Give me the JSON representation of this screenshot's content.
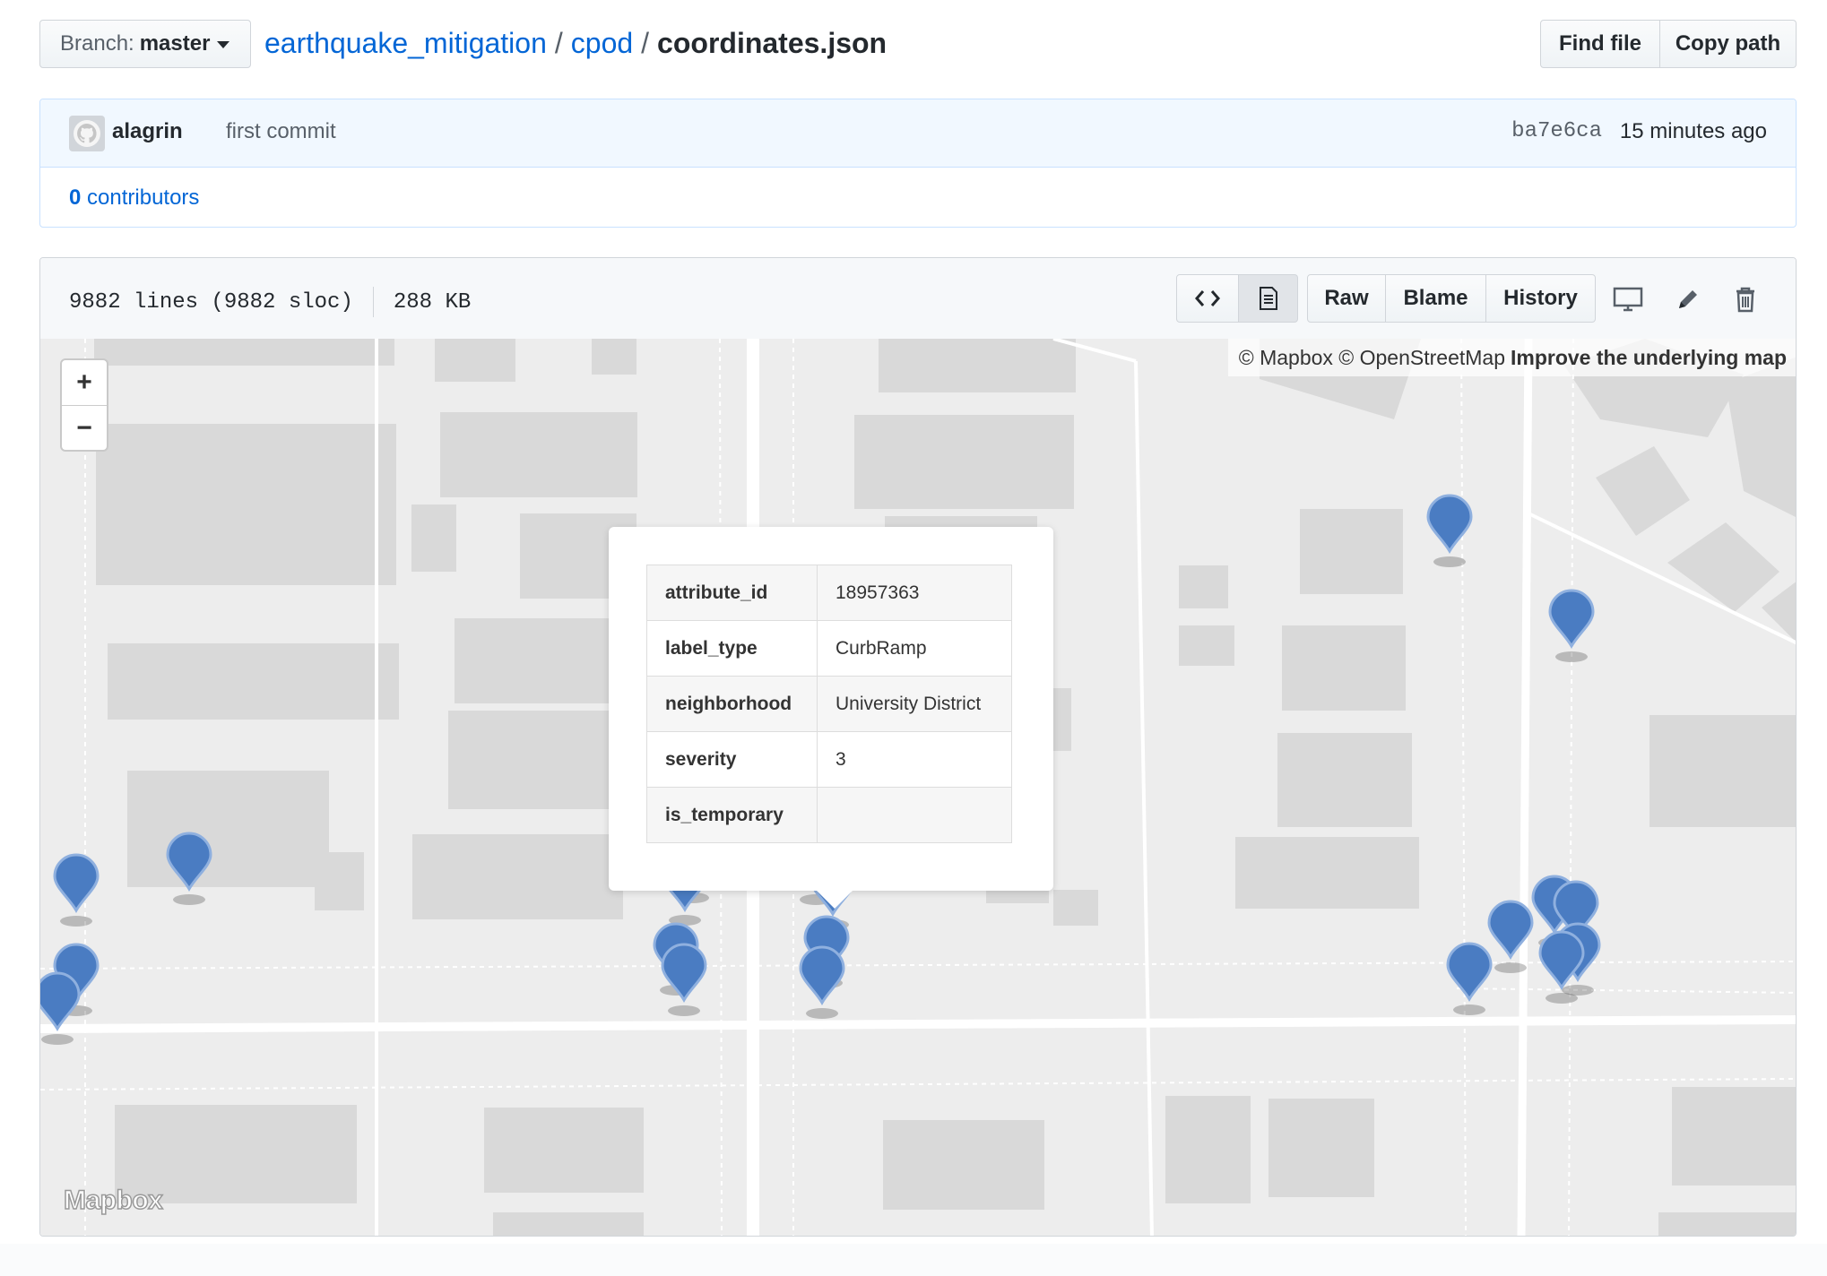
{
  "header": {
    "branch_prefix": "Branch:",
    "branch_name": "master",
    "breadcrumb": [
      "earthquake_mitigation",
      "cpod",
      "coordinates.json"
    ],
    "breadcrumb_sep": "/",
    "find_file_label": "Find file",
    "copy_path_label": "Copy path"
  },
  "commit": {
    "author": "alagrin",
    "message": "first commit",
    "sha": "ba7e6ca",
    "time_ago": "15 minutes ago",
    "contributors_count": "0",
    "contributors_label": "contributors"
  },
  "file": {
    "lines": "9882 lines (9882 sloc)",
    "size": "288 KB",
    "raw_label": "Raw",
    "blame_label": "Blame",
    "history_label": "History"
  },
  "map": {
    "zoom_in": "+",
    "zoom_out": "−",
    "attribution": "© Mapbox © OpenStreetMap",
    "attribution_link": "Improve the underlying map",
    "logo": "Mapbox",
    "marker_color": "#4a7cc2",
    "popup": {
      "rows": [
        {
          "key": "attribute_id",
          "value": "18957363"
        },
        {
          "key": "label_type",
          "value": "CurbRamp"
        },
        {
          "key": "neighborhood",
          "value": "University District"
        },
        {
          "key": "severity",
          "value": "3"
        },
        {
          "key": "is_temporary",
          "value": ""
        }
      ]
    }
  }
}
